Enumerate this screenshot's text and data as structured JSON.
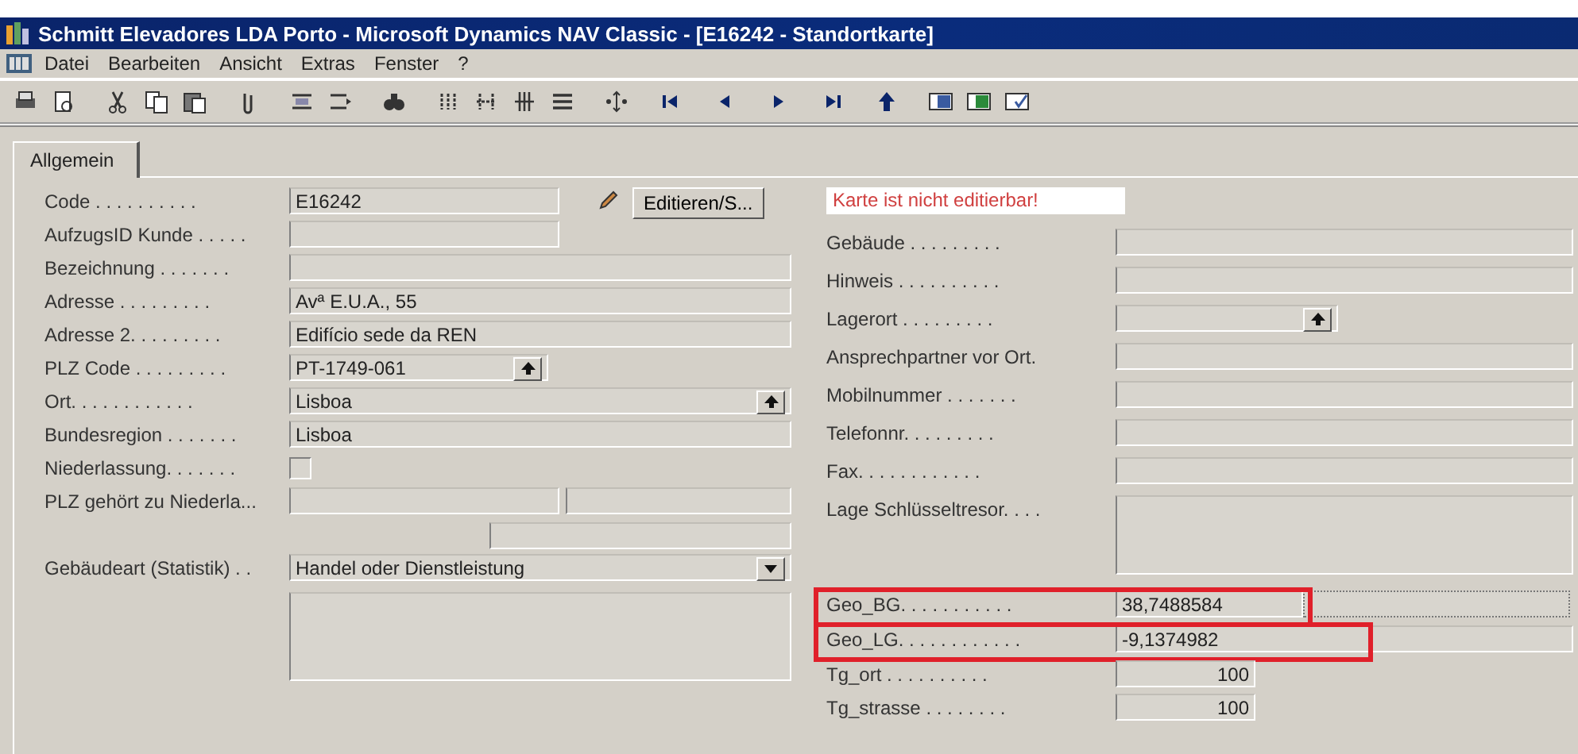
{
  "window": {
    "title": "Schmitt Elevadores LDA Porto - Microsoft Dynamics NAV Classic - [E16242 - Standortkarte]"
  },
  "menu": [
    "Datei",
    "Bearbeiten",
    "Ansicht",
    "Extras",
    "Fenster",
    "?"
  ],
  "tabs": [
    {
      "label": "Allgemein",
      "selected": true
    }
  ],
  "left": [
    {
      "kind": "short",
      "label": "Code . . . . . . . . . .",
      "value": "E16242",
      "button": "Editieren/S..."
    },
    {
      "kind": "short",
      "label": "AufzugsID Kunde . . . . ."
    },
    {
      "kind": "text",
      "label": "Bezeichnung . . . . . . ."
    },
    {
      "kind": "text",
      "label": "Adresse . . . . . . . . .",
      "value": "Avª E.U.A., 55"
    },
    {
      "kind": "text",
      "label": "Adresse 2. . . . . . . . .",
      "value": "Edifício sede da REN"
    },
    {
      "kind": "lookup_short",
      "label": "PLZ Code . . . . . . . . .",
      "value": "PT-1749-061"
    },
    {
      "kind": "lookup",
      "label": "Ort. . . . . . . . . . . .",
      "value": "Lisboa"
    },
    {
      "kind": "text",
      "label": "Bundesregion . . . . . . .",
      "value": "Lisboa"
    },
    {
      "kind": "checkbox",
      "label": "Niederlassung. . . . . . .",
      "checked": false
    },
    {
      "kind": "split",
      "label": "PLZ gehört zu Niederla..."
    },
    {
      "kind": "dropdown",
      "label": "Gebäudeart (Statistik) . .",
      "value": "Handel oder Dienstleistung"
    },
    {
      "kind": "memo"
    }
  ],
  "right": [
    {
      "kind": "notice",
      "value": "Karte ist nicht editierbar!"
    },
    {
      "kind": "text",
      "label": "Gebäude . . . . . . . . ."
    },
    {
      "kind": "text",
      "label": "Hinweis . . . . . . . . . ."
    },
    {
      "kind": "lookup_short",
      "label": "Lagerort . . . . . . . . ."
    },
    {
      "kind": "text",
      "label": "Ansprechpartner vor Ort."
    },
    {
      "kind": "text",
      "label": "Mobilnummer . . . . . . ."
    },
    {
      "kind": "text",
      "label": "Telefonnr. . . . . . . . ."
    },
    {
      "kind": "text",
      "label": "Fax. . . . . . . . . . . ."
    },
    {
      "kind": "memo",
      "label": "Lage Schlüsseltresor. . . ."
    },
    {
      "kind": "geo_ext",
      "label": "Geo_BG. . . . . . . . . . .",
      "value": "38,7488584",
      "highlighted": true
    },
    {
      "kind": "geo",
      "label": "Geo_LG. . . . . . . . . . . .",
      "value": "-9,1374982",
      "highlighted": true
    },
    {
      "kind": "number",
      "label": "Tg_ort . . . . . . . . . .",
      "value": "100"
    },
    {
      "kind": "number",
      "label": "Tg_strasse . . . . . . . .",
      "value": "100"
    }
  ]
}
